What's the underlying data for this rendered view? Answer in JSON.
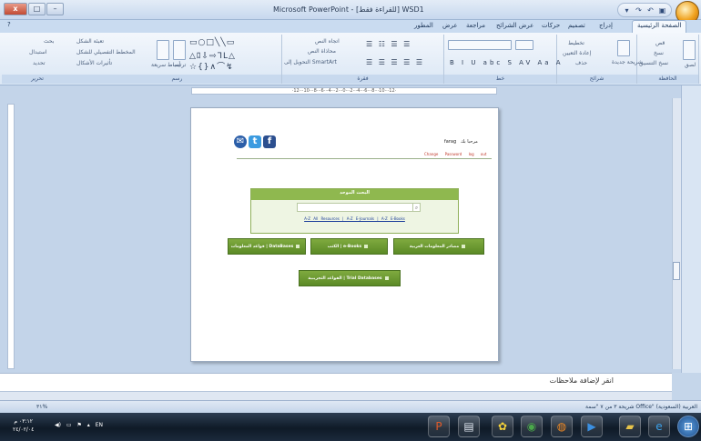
{
  "window": {
    "title": "Microsoft PowerPoint - [للقراءة فقط] WSD1",
    "close_label": "x",
    "max_label": "□",
    "min_label": "–"
  },
  "tabs": [
    "الصفحة الرئيسية",
    "إدراج",
    "تصميم",
    "حركات",
    "عرض الشرائح",
    "مراجعة",
    "عرض",
    "المطور"
  ],
  "ribbon": {
    "groups": [
      "الحافظة",
      "شرائح",
      "خط",
      "فقرة",
      "رسم",
      "تحرير"
    ],
    "clipboard": {
      "paste": "لصق",
      "cut": "قص",
      "copy": "نسخ",
      "format": "نسخ التنسيق"
    },
    "slides": {
      "new": "شريحة جديدة",
      "layout": "تخطيط",
      "reset": "إعادة التعيين",
      "delete": "حذف"
    },
    "paragraph": {
      "direction": "اتجاه النص",
      "align": "محاذاة النص",
      "smartart": "التحويل إلى SmartArt"
    },
    "drawing": {
      "arrange": "ترتيب",
      "styles": "أنماط سريعة",
      "fill": "تعبئة الشكل",
      "outline": "المخطط التفصيلي للشكل",
      "effects": "تأثيرات الأشكال"
    },
    "editing": {
      "find": "بحث",
      "replace": "استبدال",
      "select": "تحديد"
    }
  },
  "ruler_text": "·12···10···8···6···4···2···0···2···4···6···8···10···12·",
  "slide": {
    "welcome": "مرحبا بك",
    "username": "farag",
    "change_password": "Change Password",
    "logout": "log out",
    "search_title": "البحث الموحد",
    "search_button": "⌕",
    "az_links": "A-Z All Resources | A-Z E-Journals | A-Z E-Books",
    "btn_arabic_sources": "مصادر المعلومات العربية",
    "btn_ebooks": "الكتب | e-Books",
    "btn_databases": "قواعد المعلومات | DataBases",
    "btn_trial": "القواعد التجريبية | Trial Databases"
  },
  "notes_placeholder": "انقر لإضافة ملاحظات",
  "status": {
    "slide_info": "شريحة ٣ من ٧   \"سمة Office\"   العربية (السعودية)",
    "zoom": "٣١%"
  },
  "taskbar": {
    "time": "٠٣:١٢ م",
    "date": "٢٤/٠٢/٠٤",
    "lang": "EN"
  },
  "colors": {
    "accent_green": "#7faa3f",
    "link_red": "#c0392b",
    "link_blue": "#1a3d9a",
    "ribbon_blue": "#c9dbf0"
  }
}
